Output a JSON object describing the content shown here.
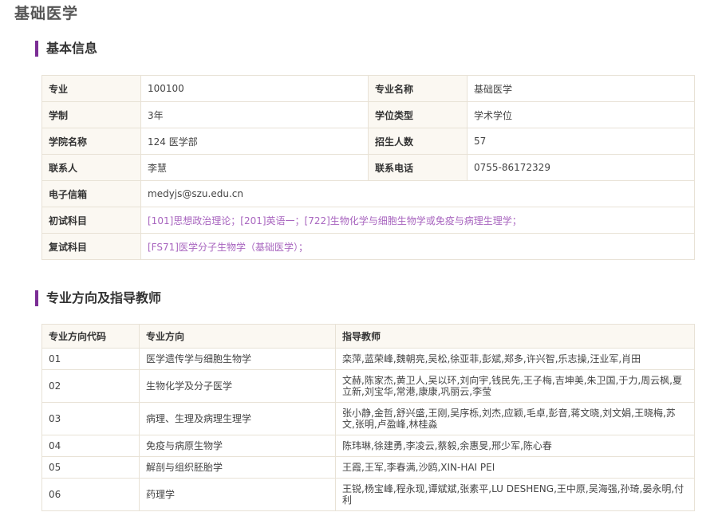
{
  "page_title": "基础医学",
  "basic_info": {
    "section_title": "基本信息",
    "rows": [
      {
        "l1": "专业",
        "v1": "100100",
        "l2": "专业名称",
        "v2": "基础医学"
      },
      {
        "l1": "学制",
        "v1": "3年",
        "l2": "学位类型",
        "v2": "学术学位"
      },
      {
        "l1": "学院名称",
        "v1": "124 医学部",
        "l2": "招生人数",
        "v2": "57"
      },
      {
        "l1": "联系人",
        "v1": "李慧",
        "l2": "联系电话",
        "v2": "0755-86172329"
      }
    ],
    "email_label": "电子信箱",
    "email_value": "medyjs@szu.edu.cn",
    "prelim_label": "初试科目",
    "prelim_value": "[101]思想政治理论；[201]英语一；[722]生物化学与细胞生物学或免疫与病理生理学；",
    "retest_label": "复试科目",
    "retest_value": "[FS71]医学分子生物学（基础医学）；",
    "link_color": "#a865bf"
  },
  "directions": {
    "section_title": "专业方向及指导教师",
    "headers": {
      "code": "专业方向代码",
      "name": "专业方向",
      "advisors": "指导教师"
    },
    "rows": [
      {
        "code": "01",
        "name": "医学遗传学与细胞生物学",
        "advisors": "栾萍,蓝荣峰,魏朝亮,吴松,徐亚菲,彭斌,郑多,许兴智,乐志操,汪业军,肖田"
      },
      {
        "code": "02",
        "name": "生物化学及分子医学",
        "advisors": "文赫,陈家杰,黄卫人,吴以环,刘向宇,钱民先,王子梅,吉坤美,朱卫国,于力,周云枫,夏立新,刘宝华,常港,康康,巩丽云,李莹"
      },
      {
        "code": "03",
        "name": "病理、生理及病理生理学",
        "advisors": "张小静,金哲,舒兴盛,王刚,吴序栎,刘杰,应颖,毛卓,彭音,蒋文晓,刘文娟,王晓梅,苏文,张明,卢盈峰,林桂淼"
      },
      {
        "code": "04",
        "name": "免疫与病原生物学",
        "advisors": "陈玮琳,徐建勇,李凌云,蔡毅,余惠旻,邢少军,陈心春"
      },
      {
        "code": "05",
        "name": "解剖与组织胚胎学",
        "advisors": "王霞,王军,李春满,沙鸥,XIN-HAI PEI"
      },
      {
        "code": "06",
        "name": "药理学",
        "advisors": "王锐,杨宝峰,程永现,谭斌斌,张素平,LU    DESHENG,王中原,吴海强,孙琦,晏永明,付利"
      }
    ]
  },
  "accent_color": "#7b2d95"
}
